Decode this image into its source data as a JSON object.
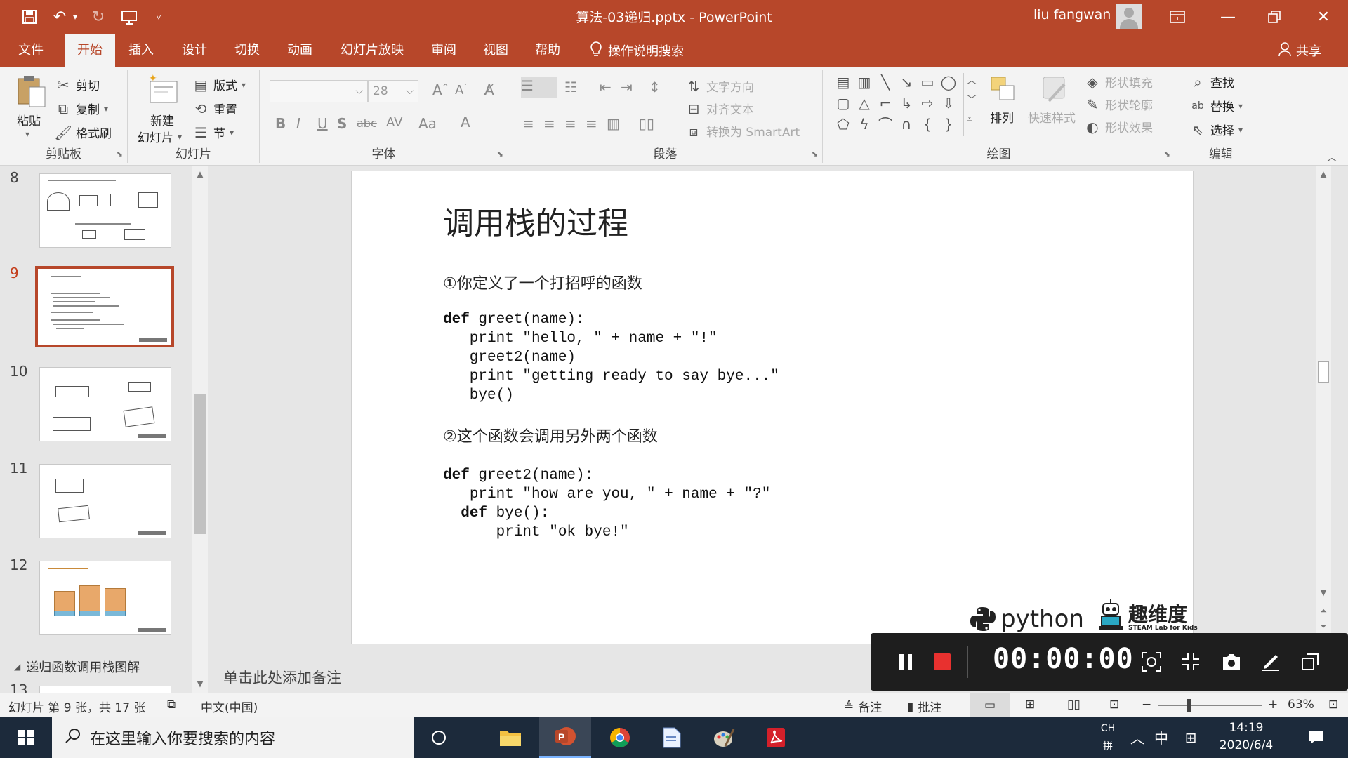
{
  "titlebar": {
    "title": "算法-03递归.pptx - PowerPoint",
    "user": "liu fangwan"
  },
  "tabs": [
    "文件",
    "开始",
    "插入",
    "设计",
    "切换",
    "动画",
    "幻灯片放映",
    "审阅",
    "视图",
    "帮助"
  ],
  "active_tab": "开始",
  "tell_me": "操作说明搜索",
  "share": "共享",
  "ribbon": {
    "clipboard": {
      "paste": "粘贴",
      "cut": "剪切",
      "copy": "复制",
      "format_painter": "格式刷",
      "label": "剪贴板"
    },
    "slides": {
      "new_slide_1": "新建",
      "new_slide_2": "幻灯片",
      "layout": "版式",
      "reset": "重置",
      "section": "节",
      "label": "幻灯片"
    },
    "font": {
      "size": "28",
      "label": "字体",
      "change_case": "Aa"
    },
    "paragraph": {
      "text_direction": "文字方向",
      "align_text": "对齐文本",
      "smartart": "转换为 SmartArt",
      "label": "段落"
    },
    "drawing": {
      "arrange": "排列",
      "quick_styles": "快速样式",
      "shape_fill": "形状填充",
      "shape_outline": "形状轮廓",
      "shape_effects": "形状效果",
      "label": "绘图"
    },
    "editing": {
      "find": "查找",
      "replace": "替换",
      "select": "选择",
      "label": "编辑"
    }
  },
  "thumbnails": [
    {
      "num": "8"
    },
    {
      "num": "9"
    },
    {
      "num": "10"
    },
    {
      "num": "11"
    },
    {
      "num": "12"
    }
  ],
  "active_slide": "9",
  "section_title": "递归函数调用栈图解",
  "slide": {
    "title": "调用栈的过程",
    "step1": "①你定义了一个打招呼的函数",
    "code1": [
      {
        "kw": "def",
        "rest": " greet(name):"
      },
      {
        "kw": "",
        "rest": "   print \"hello, \" + name + \"!\""
      },
      {
        "kw": "",
        "rest": "   greet2(name)"
      },
      {
        "kw": "",
        "rest": "   print \"getting ready to say bye...\""
      },
      {
        "kw": "",
        "rest": "   bye()"
      }
    ],
    "step2": "②这个函数会调用另外两个函数",
    "code2": [
      {
        "indent": "",
        "kw": "def",
        "rest": " greet2(name):"
      },
      {
        "indent": "  ",
        "kw": "",
        "rest": " print \"how are you, \" + name + \"?\""
      },
      {
        "indent": "  ",
        "kw": "def",
        "rest": " bye():"
      },
      {
        "indent": "     ",
        "kw": "",
        "rest": " print \"ok bye!\""
      }
    ],
    "logo_python": "python",
    "logo_qu": "趣维度",
    "logo_qu_sub": "STEAM Lab for Kids"
  },
  "notes_placeholder": "单击此处添加备注",
  "recorder": {
    "timer": "00:00:00"
  },
  "status": {
    "slide_info": "幻灯片 第 9 张，共 17 张",
    "language": "中文(中国)",
    "notes": "备注",
    "comments": "批注",
    "zoom": "63%"
  },
  "taskbar": {
    "search_placeholder": "在这里输入你要搜索的内容",
    "ime_ch": "CH",
    "ime_pin": "拼",
    "ime_zhong": "中",
    "time": "14:19",
    "date": "2020/6/4"
  },
  "colors": {
    "accent": "#b7472a",
    "active_thumb": "#c43e1c"
  }
}
